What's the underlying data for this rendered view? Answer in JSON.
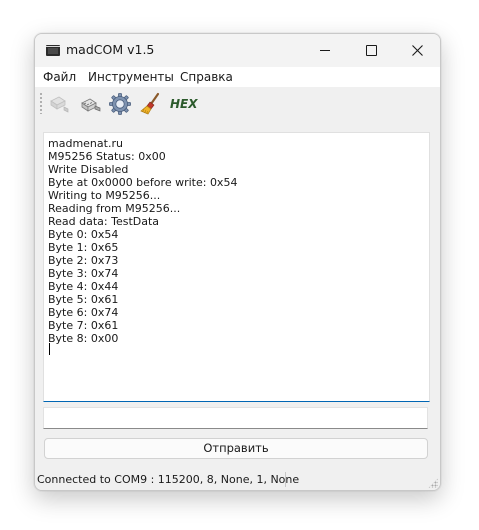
{
  "window": {
    "title": "madCOM v1.5"
  },
  "menu": {
    "file": "Файл",
    "tools": "Инструменты",
    "help": "Справка"
  },
  "toolbar": {
    "connect_icon": "plug-connect-icon",
    "disconnect_icon": "plug-disconnect-icon",
    "settings_icon": "gear-icon",
    "clear_icon": "broom-icon",
    "hex_label": "HEX"
  },
  "output": {
    "lines": [
      "madmenat.ru",
      "M95256 Status: 0x00",
      "Write Disabled",
      "Byte at 0x0000 before write: 0x54",
      "Writing to M95256...",
      "Reading from M95256...",
      "Read data: TestData",
      "Byte 0: 0x54",
      "Byte 1: 0x65",
      "Byte 2: 0x73",
      "Byte 3: 0x74",
      "Byte 4: 0x44",
      "Byte 5: 0x61",
      "Byte 6: 0x74",
      "Byte 7: 0x61",
      "Byte 8: 0x00"
    ]
  },
  "send": {
    "input_value": "",
    "button_label": "Отправить"
  },
  "status": {
    "text": "Connected to COM9 : 115200, 8, None, 1, None"
  },
  "colors": {
    "focus_accent": "#0066b4",
    "hex_text": "#2b5a2b"
  }
}
